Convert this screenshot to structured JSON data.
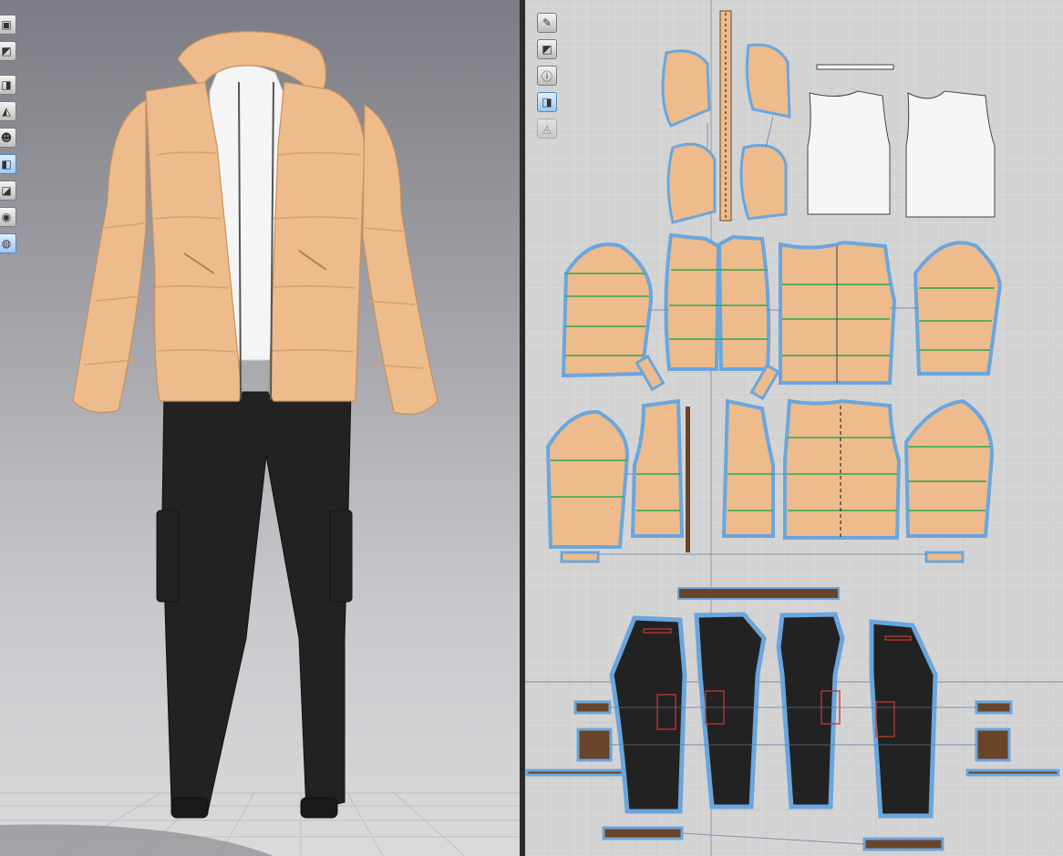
{
  "viewport_3d": {
    "toolbar": [
      {
        "icon": "avatar-display-icon"
      },
      {
        "icon": "garment-display-icon"
      },
      {
        "icon": "texture-display-icon"
      },
      {
        "icon": "fabric-render-icon"
      },
      {
        "icon": "avatar-pose-icon"
      },
      {
        "icon": "seam-display-icon"
      },
      {
        "icon": "shading-icon"
      },
      {
        "icon": "avatar-visibility-icon"
      },
      {
        "icon": "environment-icon"
      }
    ],
    "garments": [
      "puffer-jacket",
      "crewneck-tee",
      "cargo-pants"
    ]
  },
  "viewport_2d": {
    "toolbar": [
      {
        "icon": "edit-pattern-icon",
        "state": "normal"
      },
      {
        "icon": "show-garment-icon",
        "state": "normal"
      },
      {
        "icon": "info-icon",
        "state": "normal"
      },
      {
        "icon": "texture-2d-icon",
        "state": "active"
      },
      {
        "icon": "lock-garment-icon",
        "state": "disabled"
      }
    ]
  },
  "colors": {
    "jacket": "#edbb8c",
    "pants": "#222222",
    "tee": "#f5f5f5",
    "seam_outline": "#6aa6dd",
    "topstitch": "#2fa84f",
    "trim_brown": "#6a4428",
    "grid_bg": "#d4d4d4"
  }
}
